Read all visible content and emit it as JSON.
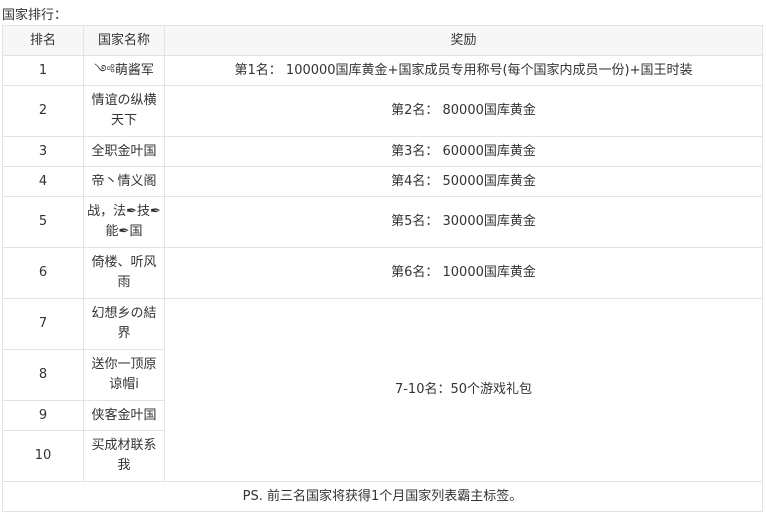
{
  "heading": "国家排行：",
  "headers": {
    "rank": "排名",
    "name": "国家名称",
    "reward": "奖励"
  },
  "rows": [
    {
      "rank": "1",
      "name": "༺萌酱军",
      "reward": "第1名： 100000国库黄金+国家成员专用称号(每个国家内成员一份)+国王时装"
    },
    {
      "rank": "2",
      "name": "情谊の纵横天下",
      "reward": "第2名： 80000国库黄金"
    },
    {
      "rank": "3",
      "name": "全职金叶国",
      "reward": "第3名： 60000国库黄金"
    },
    {
      "rank": "4",
      "name": "帝丶情义阁",
      "reward": "第4名： 50000国库黄金"
    },
    {
      "rank": "5",
      "name": "战，法✒技✒能✒国",
      "reward": "第5名： 30000国库黄金"
    },
    {
      "rank": "6",
      "name": "倚楼、听风雨",
      "reward": "第6名： 10000国库黄金"
    },
    {
      "rank": "7",
      "name": "幻想乡の結界"
    },
    {
      "rank": "8",
      "name": "送你一顶原谅帽i"
    },
    {
      "rank": "9",
      "name": "侠客金叶国"
    },
    {
      "rank": "10",
      "name": "买成材联系我"
    }
  ],
  "group_reward": "7-10名：50个游戏礼包",
  "footer": "PS. 前三名国家将获得1个月国家列表霸主标签。"
}
